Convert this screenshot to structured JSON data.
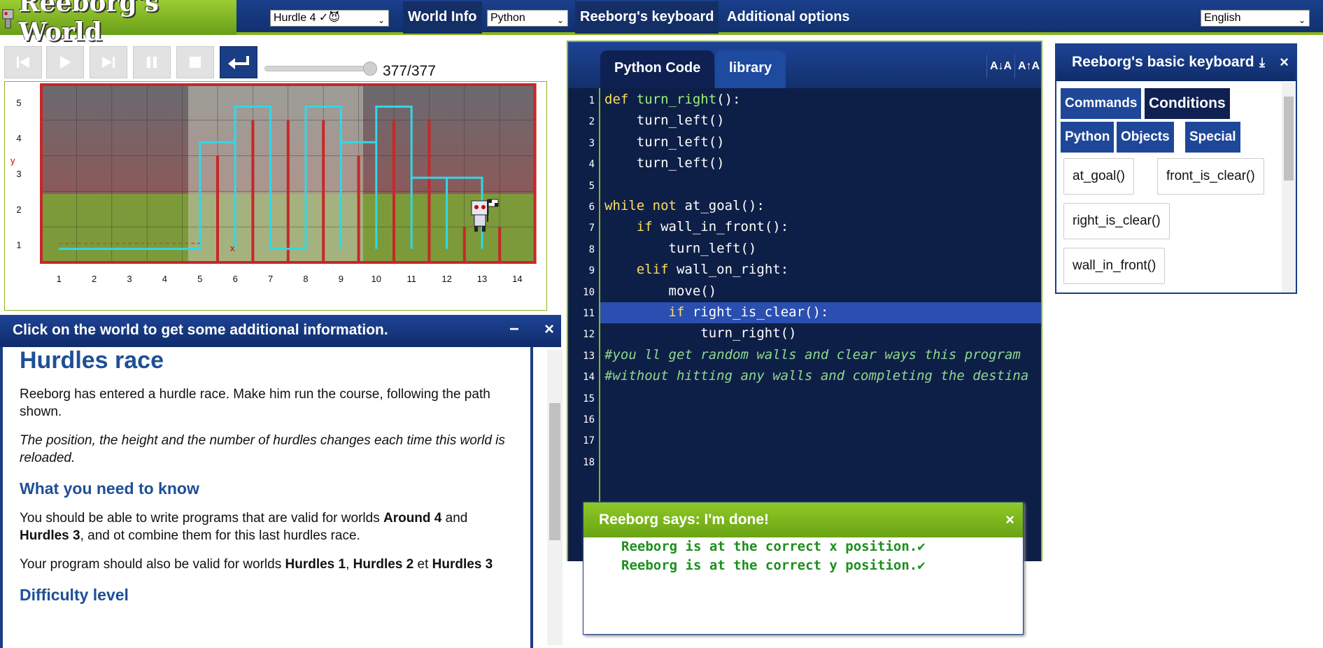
{
  "app": {
    "title": "Reeborg's World"
  },
  "topbar": {
    "world_select": "Hurdle 4 ✓😈",
    "world_info": "World Info",
    "language_select": "Python",
    "keyboard": "Reeborg's keyboard",
    "additional": "Additional options",
    "ui_language": "English"
  },
  "controls": {
    "step_counter": "377/377",
    "steps_done": 377,
    "steps_total": 377
  },
  "world": {
    "y_ticks": [
      "5",
      "4",
      "3",
      "2",
      "1"
    ],
    "x_ticks": [
      "1",
      "2",
      "3",
      "4",
      "5",
      "6",
      "7",
      "8",
      "9",
      "10",
      "11",
      "12",
      "13",
      "14"
    ],
    "x_label": "x",
    "y_label": "y"
  },
  "info_panel": {
    "bar_text": "Click on the world to get some additional information.",
    "minimize": "−",
    "close": "×",
    "title": "Hurdles race",
    "p1": "Reeborg has entered a hurdle race. Make him run the course, following the path shown.",
    "p2": "The position, the height and the number of hurdles changes each time this world is reloaded.",
    "h_need": "What you need to know",
    "p3_a": "You should be able to write programs that are valid for worlds ",
    "p3_b": "Around 4",
    "p3_c": " and ",
    "p3_d": "Hurdles 3",
    "p3_e": ", and ot combine them for this last hurdles race.",
    "p4_a": "Your program should also be valid for worlds ",
    "p4_b": "Hurdles 1",
    "p4_c": ", ",
    "p4_d": "Hurdles 2",
    "p4_e": " et ",
    "p4_f": "Hurdles 3",
    "h_diff": "Difficulty level"
  },
  "editor": {
    "tab_code": "Python Code",
    "tab_library": "library",
    "font_smaller": "A↓A",
    "font_larger": "A↑A",
    "highlight_line": 11,
    "lines": [
      {
        "n": "1",
        "t": "def turn_right():"
      },
      {
        "n": "2",
        "t": "    turn_left()"
      },
      {
        "n": "3",
        "t": "    turn_left()"
      },
      {
        "n": "4",
        "t": "    turn_left()"
      },
      {
        "n": "5",
        "t": ""
      },
      {
        "n": "6",
        "t": "while not at_goal():"
      },
      {
        "n": "7",
        "t": "    if wall_in_front():"
      },
      {
        "n": "8",
        "t": "        turn_left()"
      },
      {
        "n": "9",
        "t": "    elif wall_on_right:"
      },
      {
        "n": "10",
        "t": "        move()"
      },
      {
        "n": "11",
        "t": "        if right_is_clear():"
      },
      {
        "n": "12",
        "t": "            turn_right()"
      },
      {
        "n": "13",
        "t": "#you ll get random walls and clear ways this program"
      },
      {
        "n": "14",
        "t": "#without hitting any walls and completing the destina"
      },
      {
        "n": "15",
        "t": ""
      },
      {
        "n": "16",
        "t": ""
      },
      {
        "n": "17",
        "t": ""
      },
      {
        "n": "18",
        "t": ""
      }
    ]
  },
  "says": {
    "title": "Reeborg says: I'm done!",
    "close": "×",
    "msg1": "Reeborg is at the correct x position.✔",
    "msg2": "Reeborg is at the correct y position.✔"
  },
  "keyboard": {
    "title": "Reeborg's basic keyboard",
    "pin": "⤓",
    "close": "×",
    "tabs": [
      "Commands",
      "Conditions",
      "Python",
      "Objects",
      "Special"
    ],
    "keys": [
      "at_goal()",
      "front_is_clear()",
      "right_is_clear()",
      "wall_in_front()"
    ]
  },
  "colors": {
    "accent": "#8ab51e",
    "navy": "#1a3e86",
    "trail": "#31d8e6",
    "wall": "#c62828"
  }
}
